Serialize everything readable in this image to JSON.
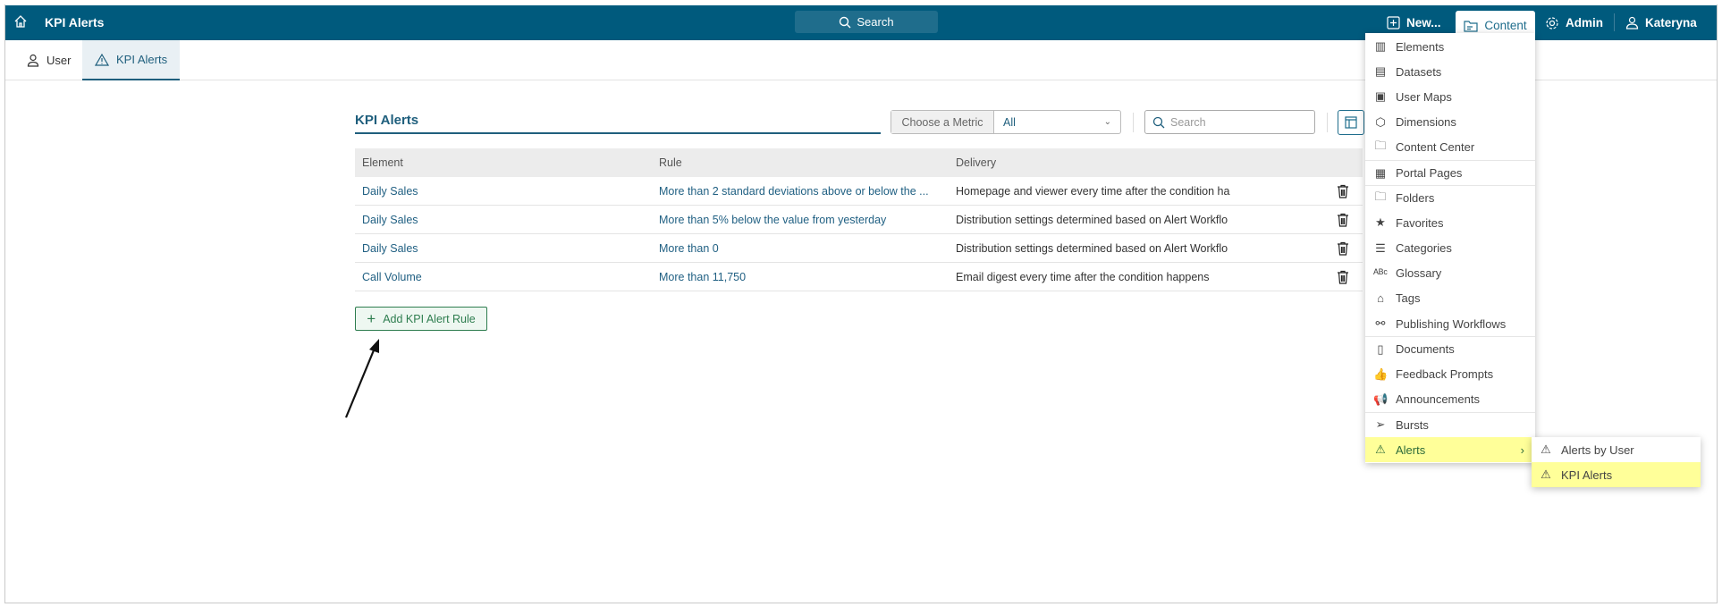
{
  "topbar": {
    "title": "KPI Alerts",
    "search_label": "Search",
    "new_label": "New...",
    "content_label": "Content",
    "admin_label": "Admin",
    "user_label": "Kateryna"
  },
  "tabs": [
    {
      "label": "User",
      "icon": "user-icon"
    },
    {
      "label": "KPI Alerts",
      "icon": "warning-icon",
      "active": true
    }
  ],
  "page": {
    "title": "KPI Alerts",
    "metric_filter": {
      "label": "Choose a Metric",
      "value": "All"
    },
    "search_placeholder": "Search",
    "columns": [
      "Element",
      "Rule",
      "Delivery"
    ],
    "rows": [
      {
        "element": "Daily Sales",
        "rule": "More than 2 standard deviations above or below the ...",
        "delivery": "Homepage and viewer every time after the condition ha"
      },
      {
        "element": "Daily Sales",
        "rule": "More than 5% below the value from yesterday",
        "delivery": "Distribution settings determined based on Alert Workflo"
      },
      {
        "element": "Daily Sales",
        "rule": "More than 0",
        "delivery": "Distribution settings determined based on Alert Workflo"
      },
      {
        "element": "Call Volume",
        "rule": "More than 11,750",
        "delivery": "Email digest every time after the condition happens"
      }
    ],
    "add_button": "Add KPI Alert Rule"
  },
  "content_menu": {
    "items": [
      "Elements",
      "Datasets",
      "User Maps",
      "Dimensions",
      "Content Center",
      "Portal Pages",
      "Folders",
      "Favorites",
      "Categories",
      "Glossary",
      "Tags",
      "Publishing Workflows",
      "Documents",
      "Feedback Prompts",
      "Announcements",
      "Bursts",
      "Alerts"
    ],
    "submenu": [
      "Alerts by User",
      "KPI Alerts"
    ]
  },
  "colors": {
    "topbar": "#005a7d",
    "highlight": "#ffff99",
    "link": "#1f5f82",
    "add_button": "#2e7d4f"
  }
}
